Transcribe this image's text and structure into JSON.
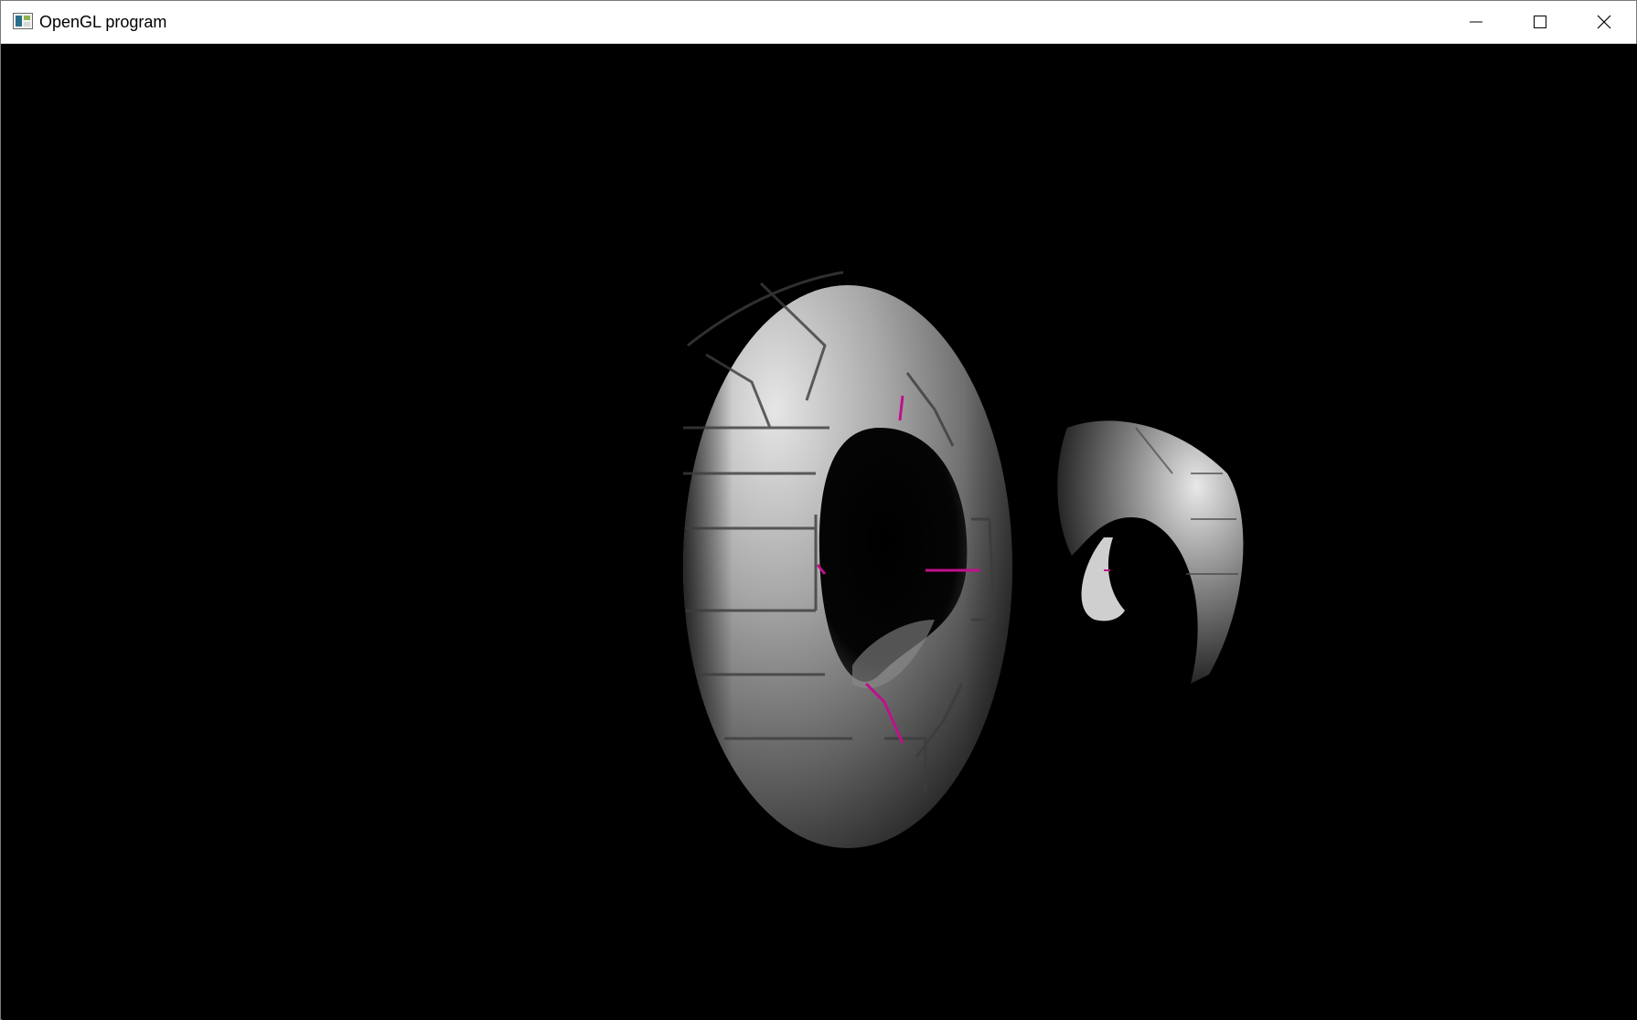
{
  "window": {
    "title": "OpenGL program",
    "controls": {
      "minimize": "minimize-icon",
      "maximize": "maximize-icon",
      "close": "close-icon"
    }
  },
  "scene": {
    "background": "#000000",
    "objects": [
      {
        "name": "large-torus",
        "color": "#b8b8b8"
      },
      {
        "name": "small-torus",
        "color": "#a8a8a8"
      }
    ],
    "accent": "#c0108c"
  }
}
